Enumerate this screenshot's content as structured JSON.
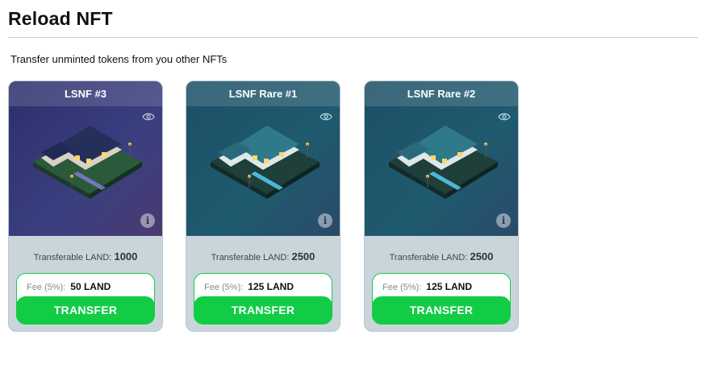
{
  "modal": {
    "title": "Reload NFT",
    "subtitle": "Transfer unminted tokens from you other NFTs"
  },
  "cards": [
    {
      "name": "LSNF #3",
      "transferable_label": "Transferable LAND:",
      "transferable_value": "1000",
      "fee_label": "Fee (5%):",
      "fee_value": "50 LAND",
      "button_label": "TRANSFER",
      "theme_color": "#3b3f7a"
    },
    {
      "name": "LSNF Rare #1",
      "transferable_label": "Transferable LAND:",
      "transferable_value": "2500",
      "fee_label": "Fee (5%):",
      "fee_value": "125 LAND",
      "button_label": "TRANSFER",
      "theme_color": "#1f5a6e"
    },
    {
      "name": "LSNF Rare #2",
      "transferable_label": "Transferable LAND:",
      "transferable_value": "2500",
      "fee_label": "Fee (5%):",
      "fee_value": "125 LAND",
      "button_label": "TRANSFER",
      "theme_color": "#1f5a6e"
    }
  ],
  "icons": {
    "view": "eye-icon",
    "info": "info-icon"
  },
  "colors": {
    "accent_green": "#12cc45",
    "card_footer": "#c9d5db"
  }
}
